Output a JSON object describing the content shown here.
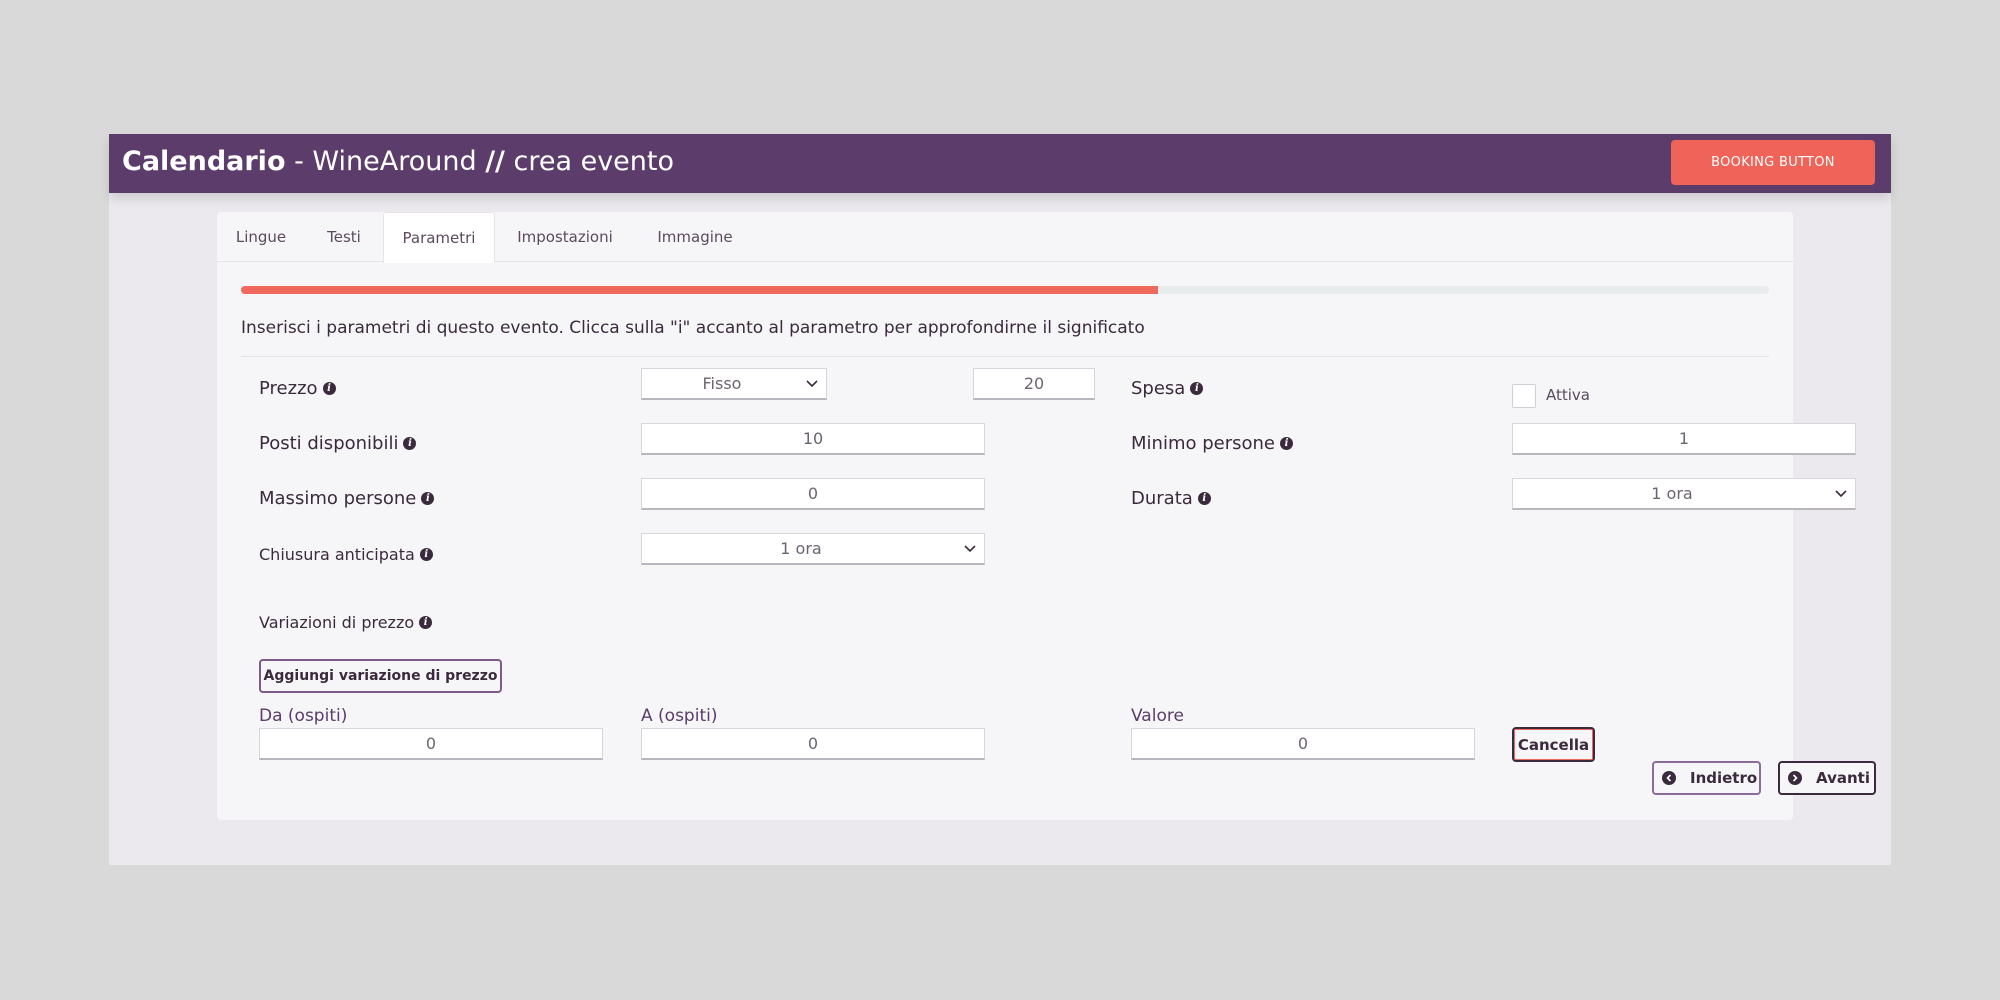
{
  "header": {
    "title_bold": "Calendario",
    "title_rest": " - WineAround ",
    "title_slashes": "//",
    "title_end": " crea evento",
    "booking_button": "BOOKING BUTTON"
  },
  "tabs": [
    {
      "label": "Lingue",
      "active": false
    },
    {
      "label": "Testi",
      "active": false
    },
    {
      "label": "Parametri",
      "active": true
    },
    {
      "label": "Impostazioni",
      "active": false
    },
    {
      "label": "Immagine",
      "active": false
    }
  ],
  "progress": {
    "percent": 60
  },
  "intro": "Inserisci i parametri di questo evento. Clicca sulla \"i\" accanto al parametro per approfondirne il significato",
  "form": {
    "prezzo": {
      "label": "Prezzo",
      "type_value": "Fisso",
      "amount": "20"
    },
    "spesa": {
      "label": "Spesa",
      "checkbox_label": "Attiva",
      "checked": false
    },
    "posti": {
      "label": "Posti disponibili",
      "value": "10"
    },
    "minimo": {
      "label": "Minimo persone",
      "value": "1"
    },
    "massimo": {
      "label": "Massimo persone",
      "value": "0"
    },
    "durata": {
      "label": "Durata",
      "value": "1 ora"
    },
    "chiusura": {
      "label": "Chiusura anticipata",
      "value": "1 ora"
    },
    "variazioni": {
      "label": "Variazioni di prezzo",
      "add_button": "Aggiungi variazione di prezzo",
      "da_label": "Da (ospiti)",
      "da_value": "0",
      "a_label": "A (ospiti)",
      "a_value": "0",
      "valore_label": "Valore",
      "valore_value": "0",
      "cancel_button": "Cancella"
    }
  },
  "nav": {
    "back": "Indietro",
    "next": "Avanti"
  },
  "colors": {
    "header": "#5b3c6a",
    "accent": "#ef6358",
    "text": "#3b2a3d"
  }
}
